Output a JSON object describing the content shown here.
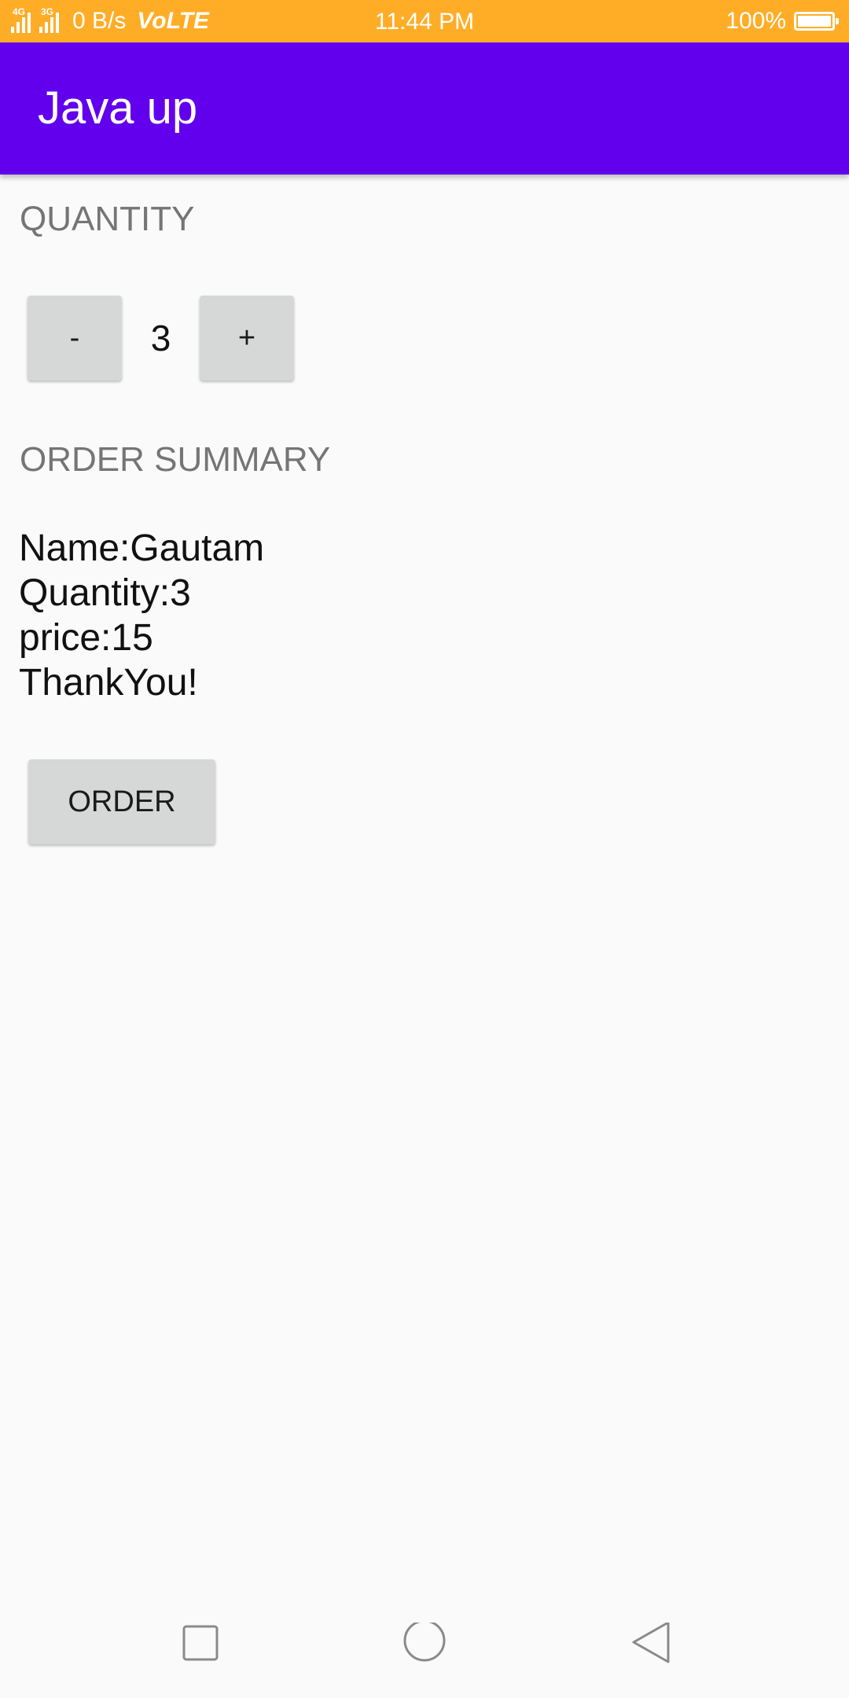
{
  "status_bar": {
    "network_4g": "4G",
    "network_3g": "3G",
    "speed": "0 B/s",
    "volte": "VoLTE",
    "time": "11:44 PM",
    "battery_percent": "100%",
    "icons": [
      "signal-4g-icon",
      "signal-3g-icon",
      "battery-icon"
    ]
  },
  "app_bar": {
    "title": "Java up",
    "color": "#6200ee"
  },
  "quantity": {
    "header": "QUANTITY",
    "decrement_label": "-",
    "value": "3",
    "increment_label": "+"
  },
  "order_summary": {
    "header": "ORDER SUMMARY",
    "lines": [
      "Name:Gautam",
      "Quantity:3",
      "price:15",
      "ThankYou!"
    ]
  },
  "order_button": {
    "label": "ORDER"
  },
  "nav_bar": {
    "icons": [
      "recents-square-icon",
      "home-circle-icon",
      "back-triangle-icon"
    ]
  },
  "colors": {
    "status_bar": "#ffad27",
    "primary": "#6200ee",
    "button_bg": "#d6d7d7",
    "background": "#fafafa"
  }
}
